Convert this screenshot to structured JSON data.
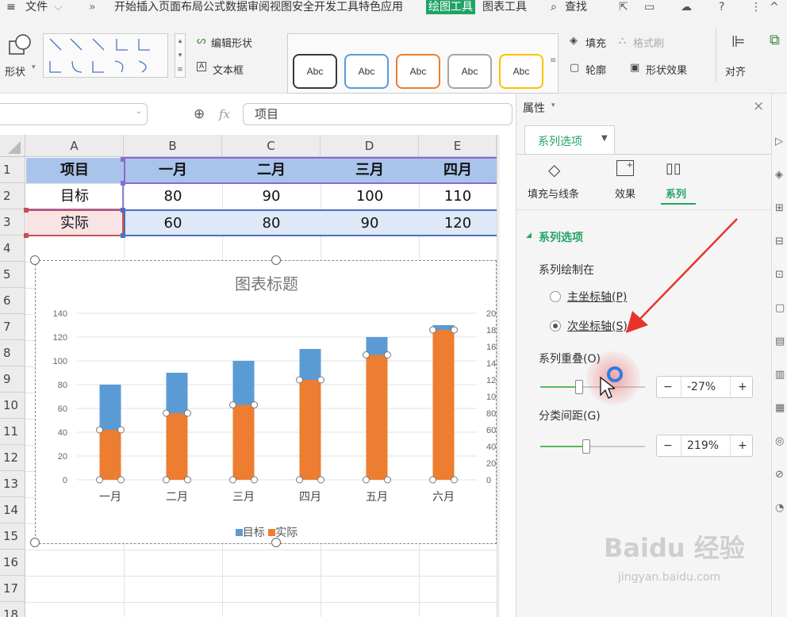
{
  "menubar": {
    "hamburger": "≡",
    "file": "文件",
    "more": "»",
    "tabs": [
      "开始",
      "插入",
      "页面布局",
      "公式",
      "数据",
      "审阅",
      "视图",
      "安全",
      "开发工具",
      "特色应用"
    ],
    "active_tab": "绘图工具",
    "chart_tools": "图表工具",
    "search": "查找",
    "help": "?"
  },
  "ribbon": {
    "shape": "形状",
    "edit_shape": "编辑形状",
    "textbox": "文本框",
    "style_boxes": [
      {
        "label": "Abc",
        "color": "#3a3a3a"
      },
      {
        "label": "Abc",
        "color": "#5b9bd5"
      },
      {
        "label": "Abc",
        "color": "#ed7d31"
      },
      {
        "label": "Abc",
        "color": "#a5a5a5"
      },
      {
        "label": "Abc",
        "color": "#ffc000"
      }
    ],
    "fill": "填充",
    "format_brush": "格式刷",
    "outline": "轮廓",
    "shape_effect": "形状效果",
    "align": "对齐"
  },
  "formula_bar": {
    "fx": "fx",
    "value": "项目"
  },
  "sheet": {
    "columns": [
      "A",
      "B",
      "C",
      "D",
      "E"
    ],
    "rows": [
      "1",
      "2",
      "3",
      "4",
      "5",
      "6",
      "7",
      "8",
      "9",
      "10",
      "11",
      "12",
      "13",
      "14",
      "15",
      "16",
      "17",
      "18"
    ],
    "table": {
      "header": [
        "项目",
        "一月",
        "二月",
        "三月",
        "四月"
      ],
      "row2": [
        "目标",
        "80",
        "90",
        "100",
        "110"
      ],
      "row3": [
        "实际",
        "60",
        "80",
        "90",
        "120"
      ]
    }
  },
  "chart_data": {
    "type": "bar",
    "title": "图表标题",
    "categories": [
      "一月",
      "二月",
      "三月",
      "四月",
      "五月",
      "六月"
    ],
    "series": [
      {
        "name": "目标",
        "values": [
          80,
          90,
          100,
          110,
          120,
          130
        ],
        "color": "#5b9bd5",
        "axis": "primary"
      },
      {
        "name": "实际",
        "values": [
          60,
          80,
          90,
          120,
          150,
          180
        ],
        "color": "#ed7d31",
        "axis": "secondary"
      }
    ],
    "y_ticks": [
      "140",
      "120",
      "100",
      "80",
      "60",
      "40",
      "20",
      "0"
    ],
    "ylim": [
      0,
      140
    ],
    "y2_ticks": [
      "20",
      "18",
      "16",
      "14",
      "12",
      "10",
      "80",
      "60",
      "40",
      "20",
      "0"
    ],
    "y2lim": [
      0,
      200
    ],
    "legend": "bottom",
    "grid": true
  },
  "pane": {
    "title": "属性",
    "close": "×",
    "tab": "系列选项",
    "icons": [
      {
        "label": "填充与线条"
      },
      {
        "label": "效果"
      },
      {
        "label": "系列"
      }
    ],
    "section": "系列选项",
    "plot_on": "系列绘制在",
    "primary_axis": "主坐标轴(P)",
    "secondary_axis": "次坐标轴(S)",
    "overlap_label": "系列重叠(O)",
    "overlap_value": "-27%",
    "overlap_level": 0.37,
    "gap_label": "分类间距(G)",
    "gap_value": "219%",
    "gap_level": 0.44,
    "minus": "−",
    "plus": "+"
  },
  "watermark": {
    "brand": "Baidu 经验",
    "url": "jingyan.baidu.com"
  },
  "colors": {
    "accent_green": "#21a366",
    "header_fill": "#a9c4eb",
    "row3_fill": "#dfe8f7",
    "annotation_red": "#e8332d"
  }
}
